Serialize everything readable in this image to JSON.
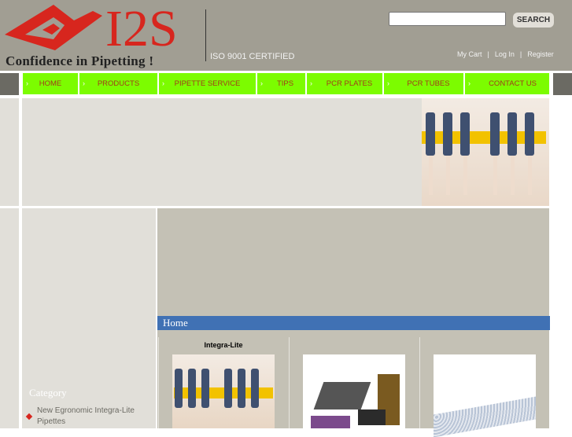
{
  "header": {
    "brand": "I2S",
    "slogan": "Confidence in Pipetting !",
    "certification": "ISO 9001 CERTIFIED",
    "search": {
      "value": "",
      "placeholder": "",
      "button": "SEARCH"
    },
    "links": [
      "My Cart",
      "|",
      "Log In",
      "|",
      "Register"
    ]
  },
  "nav": {
    "items": [
      "HOME",
      "PRODUCTS",
      "PIPETTE SERVICE",
      "TIPS",
      "PCR PLATES",
      "PCR TUBES",
      "CONTACT US"
    ],
    "chevron": "›"
  },
  "sidebar": {
    "heading": "Category",
    "items": [
      "New Egronomic Integra-Lite Pipettes"
    ]
  },
  "main": {
    "section_title": "Home",
    "products": [
      {
        "title": "Integra-Lite"
      },
      {
        "title": ""
      },
      {
        "title": ""
      }
    ]
  },
  "colors": {
    "header": "#a19e93",
    "nav": "#7cfc00",
    "nav_text": "#a23a1a",
    "brand": "#d7261e",
    "section_bar": "#4071b4"
  }
}
